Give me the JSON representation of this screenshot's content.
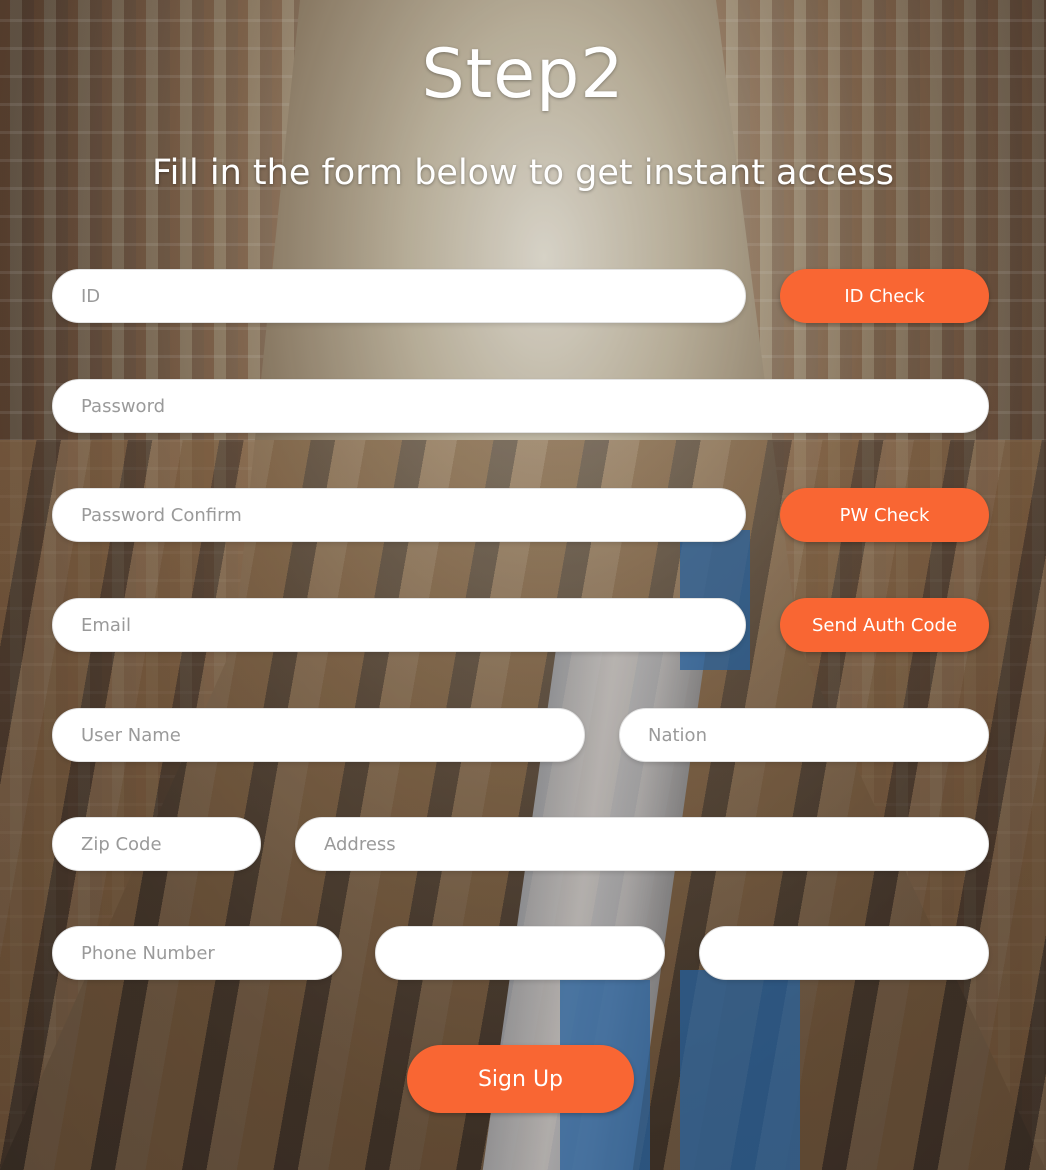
{
  "header": {
    "title": "Step2",
    "subtitle": "Fill in the form below to get instant access"
  },
  "form": {
    "id_placeholder": "ID",
    "id_check_label": "ID Check",
    "password_placeholder": "Password",
    "password_confirm_placeholder": "Password Confirm",
    "pw_check_label": "PW Check",
    "email_placeholder": "Email",
    "send_auth_code_label": "Send Auth Code",
    "user_name_placeholder": "User Name",
    "nation_placeholder": "Nation",
    "zip_code_placeholder": "Zip Code",
    "address_placeholder": "Address",
    "phone_number_placeholder": "Phone Number",
    "phone_middle_placeholder": "",
    "phone_last_placeholder": "",
    "sign_up_label": "Sign Up"
  },
  "colors": {
    "accent": "#f96633",
    "text_on_accent": "#ffffff",
    "input_bg": "#ffffff",
    "placeholder": "#9a9a9a"
  },
  "background": {
    "icon": "warehouse-photo"
  }
}
